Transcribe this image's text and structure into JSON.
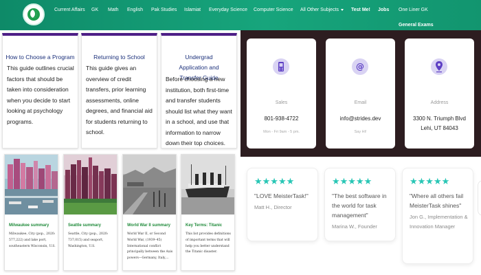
{
  "nav": {
    "items": [
      "Current Affairs",
      "GK",
      "Math",
      "English",
      "Pak Studies",
      "Islamiat",
      "Everyday Science",
      "Computer Science",
      "All Other Subjects",
      "Test Me!",
      "Jobs",
      "One Liner GK"
    ],
    "second_row": "General Exams"
  },
  "guides": [
    {
      "title": "How to Choose a Program",
      "body": "This guide outlines crucial factors that should be taken into consideration when you decide to start looking at psychology programs."
    },
    {
      "title": "Returning to School",
      "body": "This guide gives an overview of credit transfers, prior learning assessments, online degrees, and financial aid for students returning to school."
    },
    {
      "title": "Undergrad Application and Transfer Guide",
      "body": "Before choosing a new institution, both first-time and transfer students should list what they want in a school, and use that information to narrow down their top choices."
    }
  ],
  "photos": [
    {
      "title": "Milwaukee summary",
      "text": "Milwaukee, City (pop., 2020: 577,222) and lake port, southeastern Wisconsin, U.S."
    },
    {
      "title": "Seattle summary",
      "text": "Seattle, City (pop., 2020: 737,015) and seaport, Washington, U.S."
    },
    {
      "title": "World War II summary",
      "text": "World War II, or Second World War, (1939–45) International conflict principally between the Axis powers—Germany, Italy,..."
    },
    {
      "title": "Key Terms: Titanic",
      "text": "This list provides definitions of important terms that will help you better understand the Titanic disaster."
    }
  ],
  "contacts": [
    {
      "label": "Sales",
      "value": "801-938-4722",
      "sub": "Mon - Fri 9am - 5 pm.",
      "icon": "phone-icon"
    },
    {
      "label": "Email",
      "value": "info@strides.dev",
      "sub": "Say Hi!",
      "icon": "at-sign-icon"
    },
    {
      "label": "Address",
      "value": "3300 N. Triumph Blvd Lehi, UT 84043",
      "sub": "",
      "icon": "map-pin-icon"
    }
  ],
  "reviews": [
    {
      "stars": "★★★★★",
      "quote": "\"LOVE MeisterTask!\"",
      "author": "Matt H., Director"
    },
    {
      "stars": "★★★★★",
      "quote": "\"The best software in the world for task management\"",
      "author": "Marina W., Founder"
    },
    {
      "stars": "★★★★★",
      "quote": "\"Where all others fail MeisterTask shines\"",
      "author": "Jon G., Implementation & Innovation Manager"
    }
  ],
  "colors": {
    "nav": "#17a57c",
    "guide_accent": "#4d1e86",
    "dark_bg": "#2d1d20",
    "star": "#28c6b5",
    "icon_bg": "#d9d3f3",
    "icon_fg": "#5d3fc4"
  }
}
